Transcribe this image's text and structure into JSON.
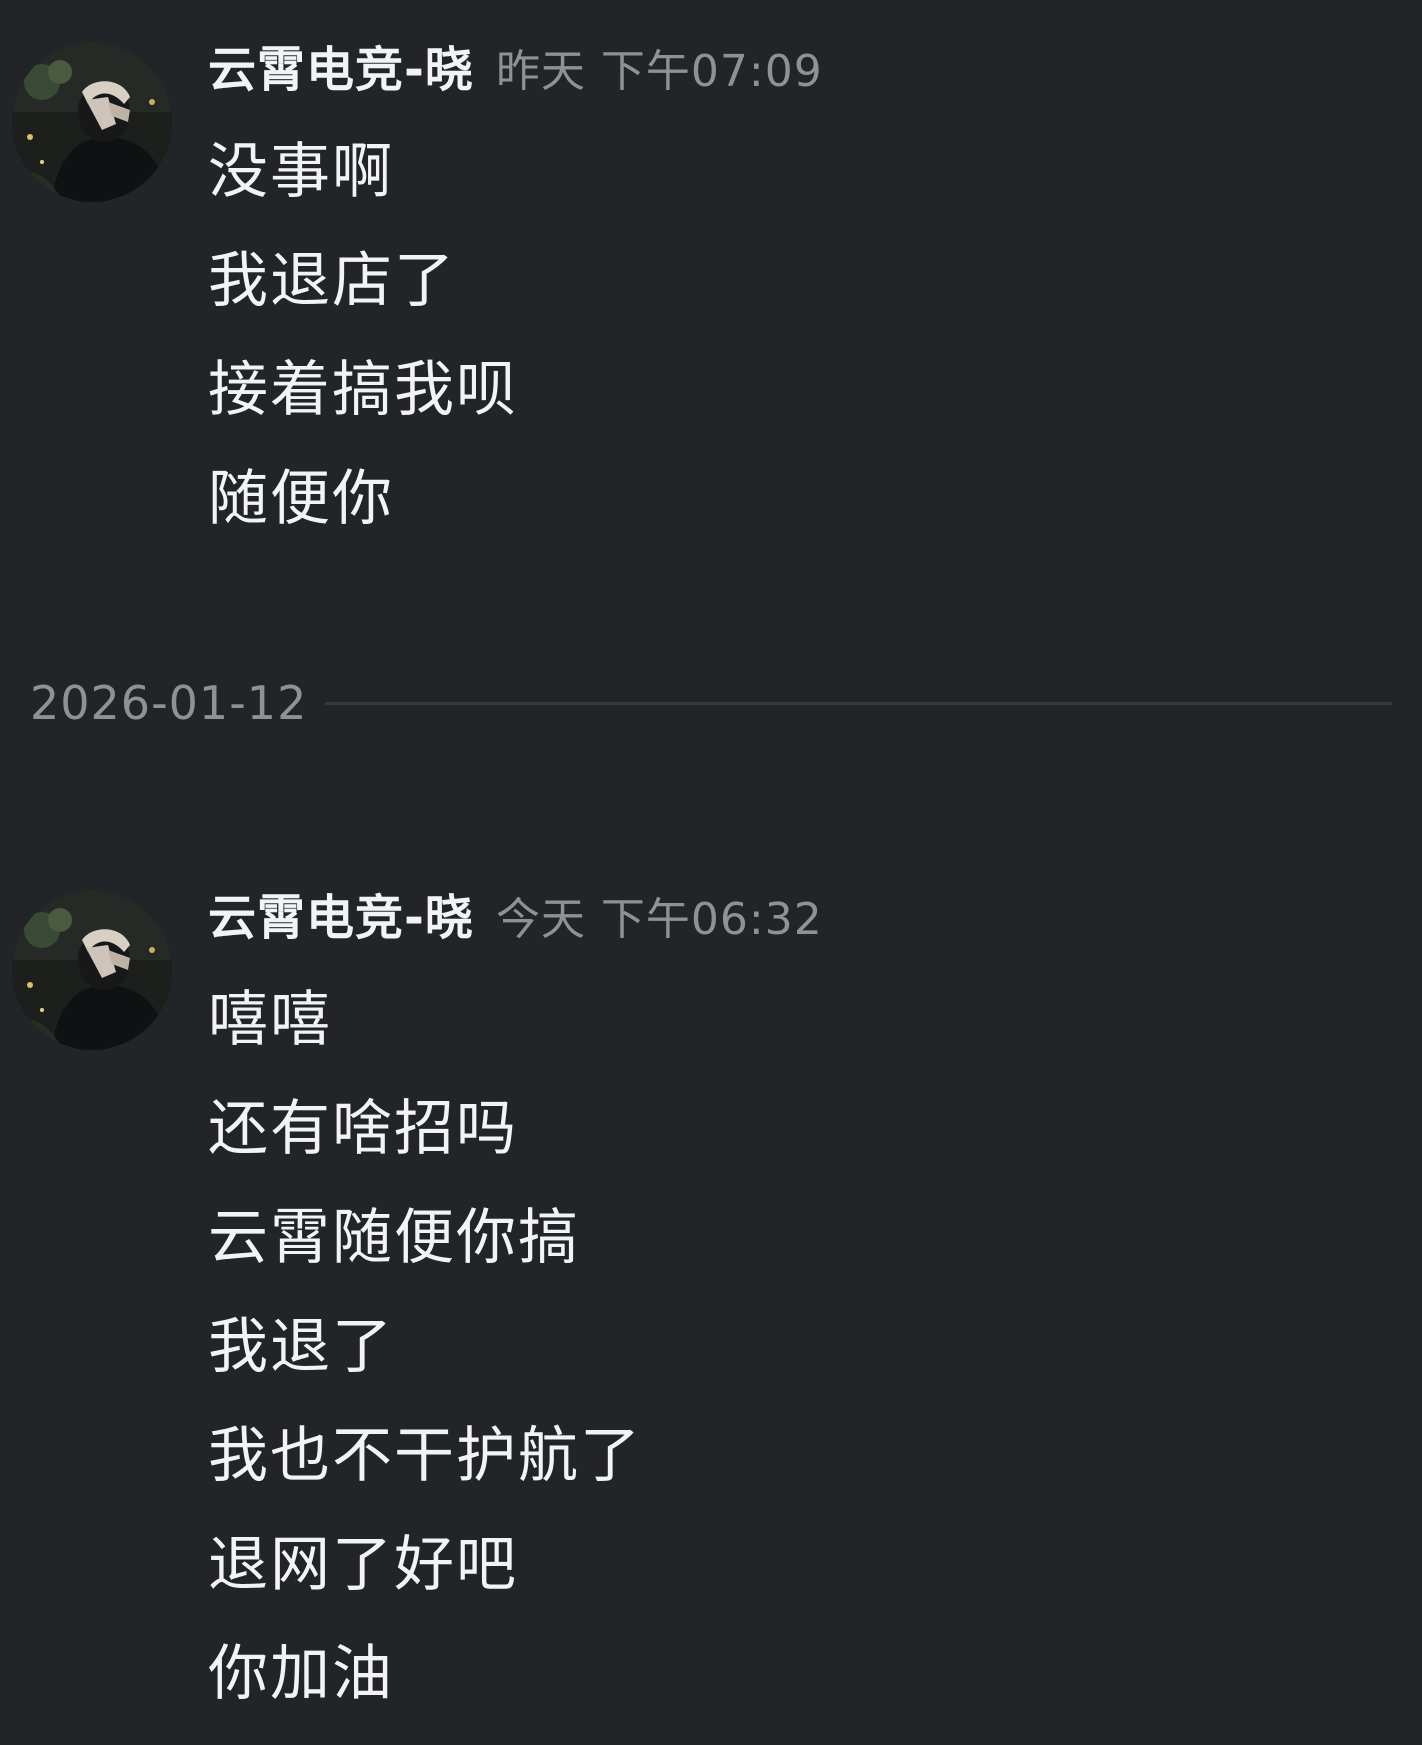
{
  "messages": [
    {
      "username": "云霄电竞-晓",
      "timestamp": "昨天 下午07:09",
      "lines": [
        "没事啊",
        "我退店了",
        "接着搞我呗",
        "随便你"
      ]
    },
    {
      "username": "云霄电竞-晓",
      "timestamp": "今天 下午06:32",
      "lines": [
        "嘻嘻",
        "还有啥招吗",
        "云霄随便你搞",
        "我退了",
        "我也不干护航了",
        "退网了好吧",
        "你加油"
      ]
    }
  ],
  "divider": {
    "date": "2026-01-12"
  },
  "colors": {
    "background": "#232428",
    "text": "#f2f3f5",
    "muted": "#8e9196",
    "divider": "#36383d"
  },
  "icons": {
    "avatar": "user-avatar-photo"
  }
}
